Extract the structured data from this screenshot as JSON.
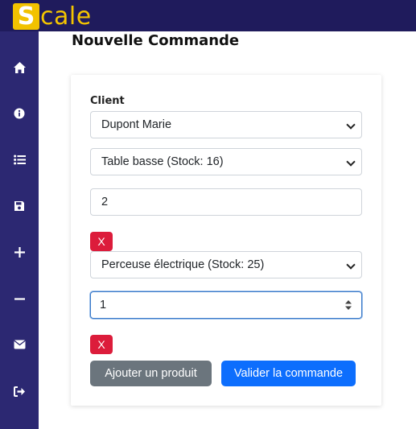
{
  "app": {
    "logo_letter": "S",
    "logo_rest": "cale"
  },
  "sidebar": {
    "items": [
      {
        "icon": "home-icon"
      },
      {
        "icon": "info-icon"
      },
      {
        "icon": "list-icon"
      },
      {
        "icon": "save-icon"
      },
      {
        "icon": "plus-icon"
      },
      {
        "icon": "minus-icon"
      },
      {
        "icon": "envelope-icon"
      },
      {
        "icon": "logout-icon"
      }
    ]
  },
  "page": {
    "title": "Nouvelle Commande"
  },
  "form": {
    "client_label": "Client",
    "client_value": "Dupont Marie",
    "lines": [
      {
        "product": "Table basse (Stock: 16)",
        "quantity": "2",
        "remove_label": "X"
      },
      {
        "product": "Perceuse électrique (Stock: 25)",
        "quantity": "1",
        "remove_label": "X"
      }
    ],
    "add_product_label": "Ajouter un produit",
    "submit_label": "Valider la commande"
  },
  "colors": {
    "topbar": "#1f1b5c",
    "sidebar": "#2c2872",
    "logo_yellow": "#f2c200",
    "danger": "#dc1c3b",
    "secondary": "#6b757d",
    "primary": "#0d6efd"
  }
}
